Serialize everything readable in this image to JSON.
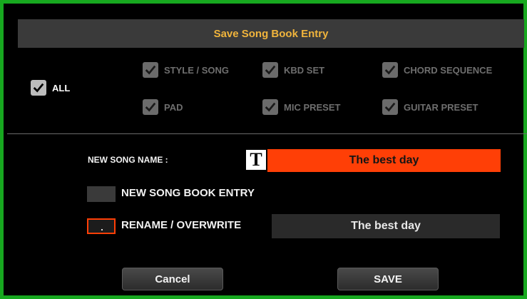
{
  "dialog": {
    "title": "Save Song Book Entry"
  },
  "checkboxes": {
    "all": {
      "label": "ALL",
      "checked": true
    },
    "style_song": {
      "label": "STYLE / SONG",
      "checked": true
    },
    "kbd_set": {
      "label": "KBD SET",
      "checked": true
    },
    "chord_sequence": {
      "label": "CHORD SEQUENCE",
      "checked": true
    },
    "pad": {
      "label": "PAD",
      "checked": true
    },
    "mic_preset": {
      "label": "MIC PRESET",
      "checked": true
    },
    "guitar_preset": {
      "label": "GUITAR PRESET",
      "checked": true
    }
  },
  "new_song_name": {
    "label": "NEW SONG NAME :",
    "text_icon": "T",
    "value": "The best day"
  },
  "options": {
    "new_entry_label": "NEW SONG BOOK ENTRY",
    "rename_label": "RENAME / OVERWRITE",
    "rename_value": "The best day",
    "selected": "rename"
  },
  "buttons": {
    "cancel": "Cancel",
    "save": "SAVE"
  },
  "colors": {
    "frame": "#17a81f",
    "title_text": "#f0b43c",
    "accent": "#ff3f06"
  }
}
